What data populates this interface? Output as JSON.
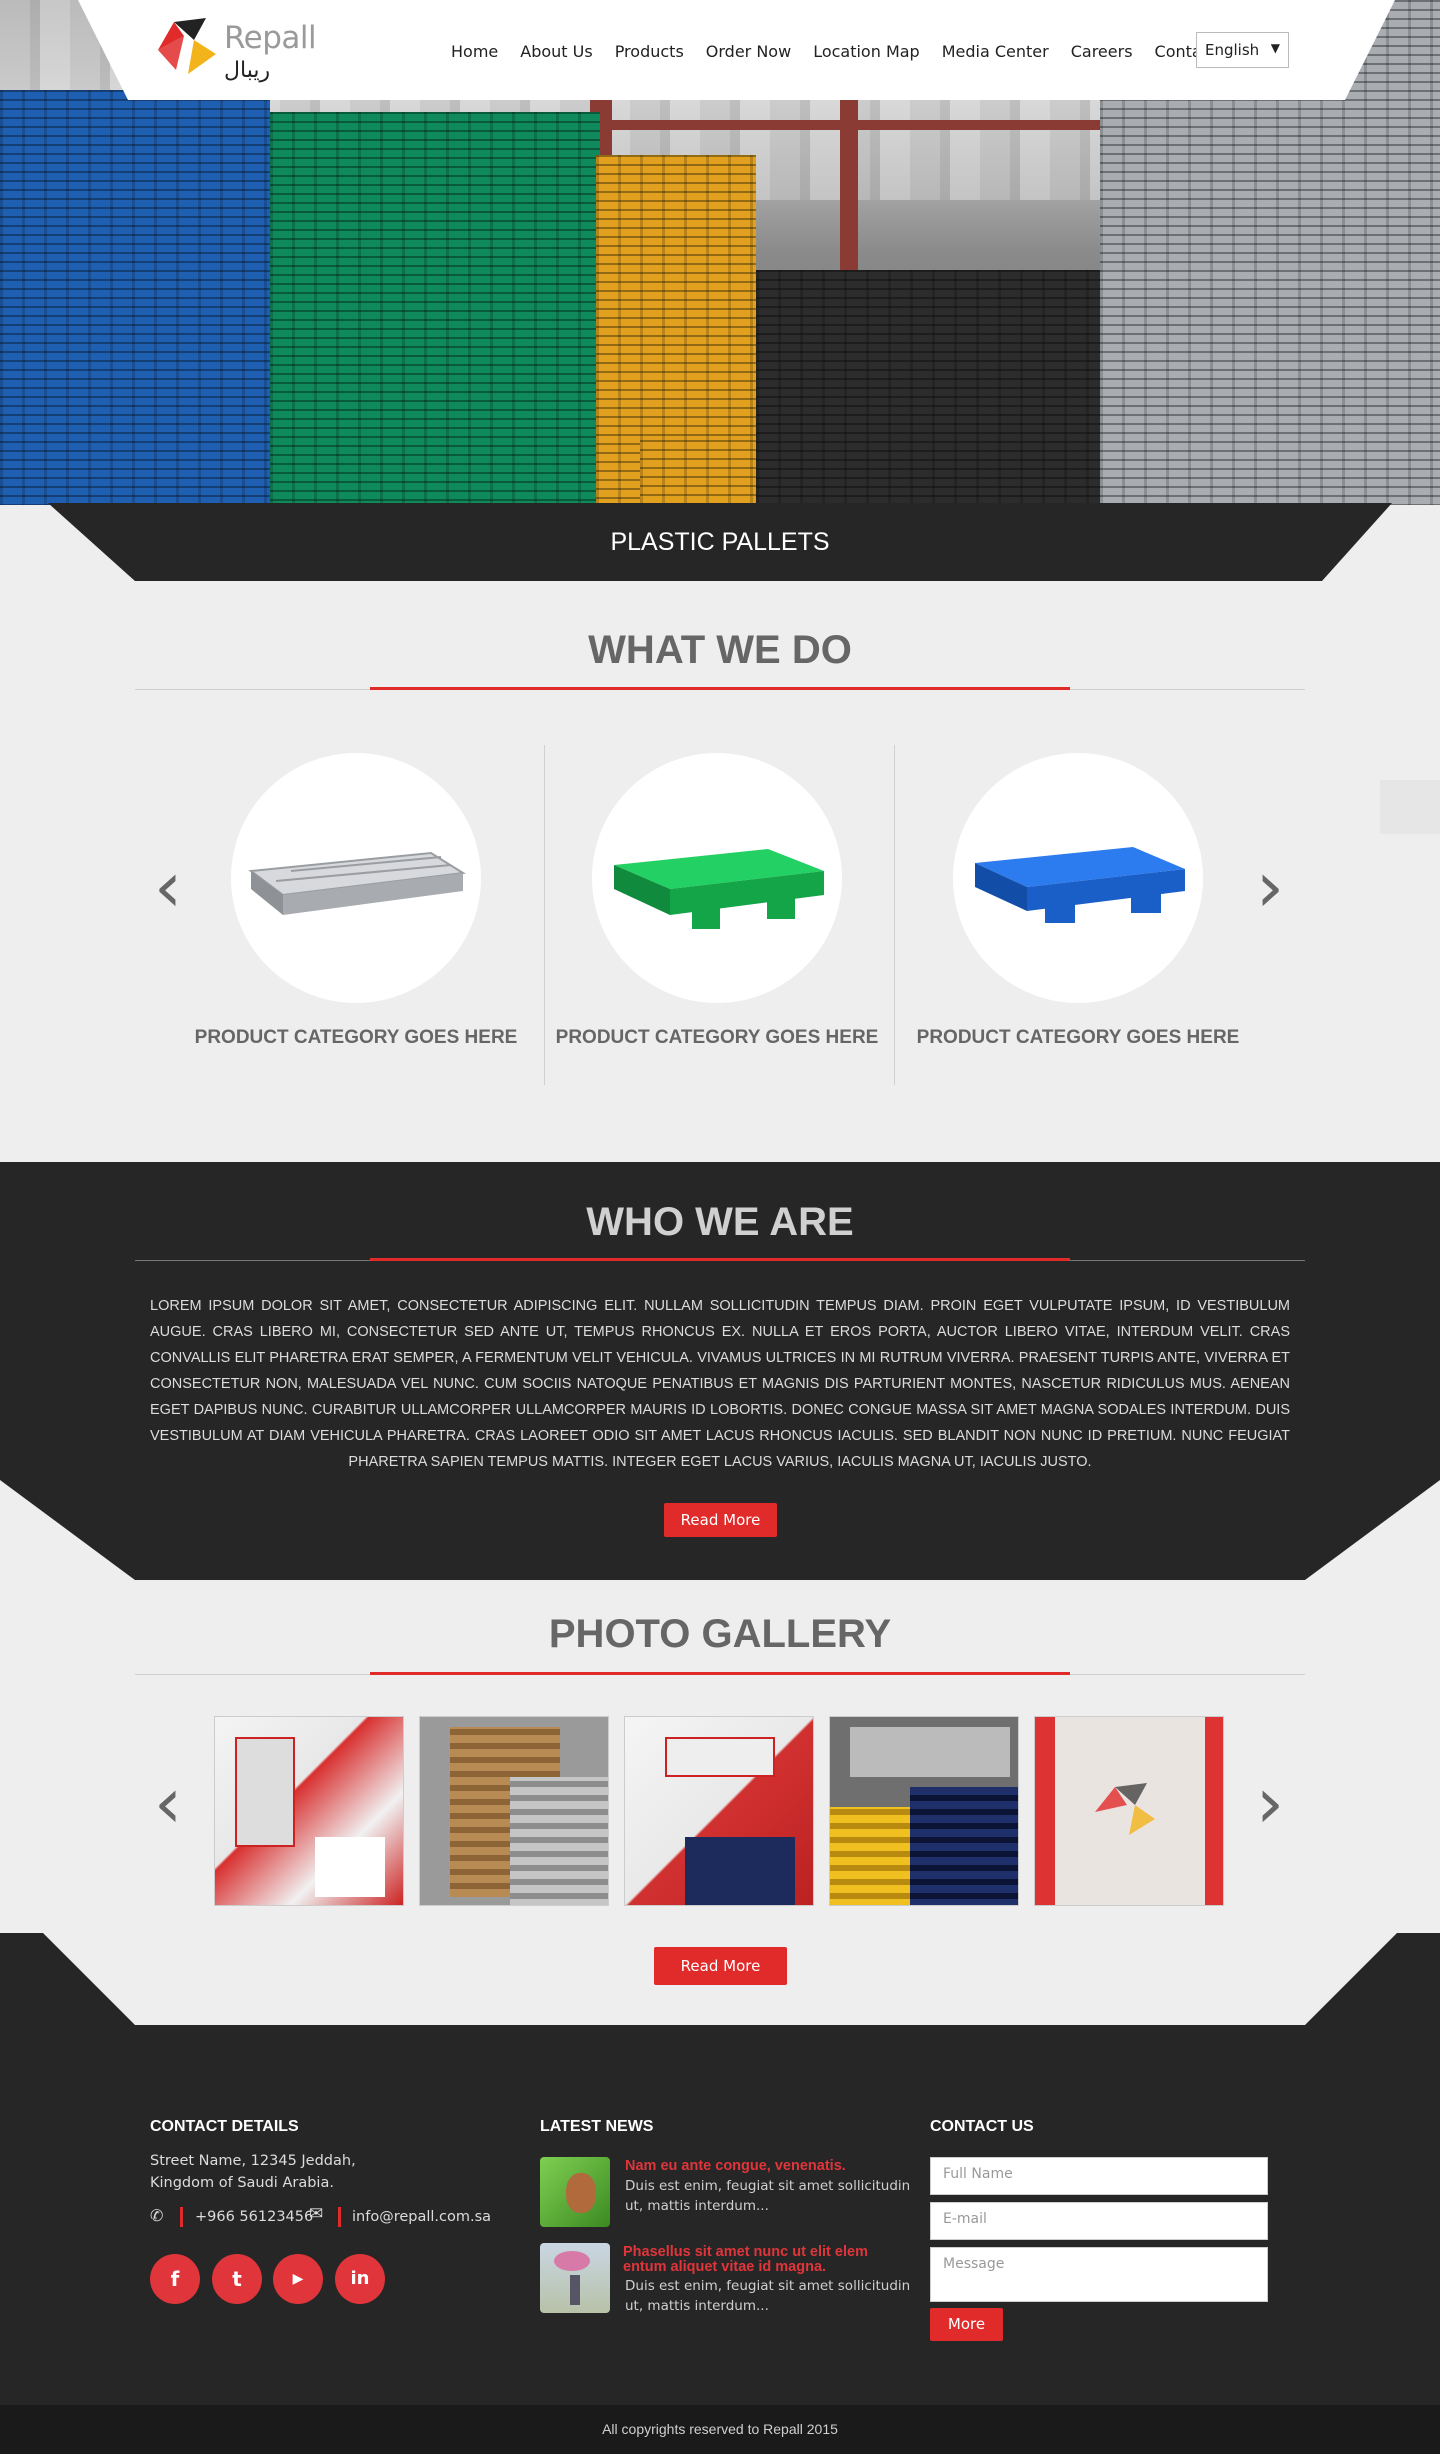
{
  "header": {
    "logo_text": "Repall",
    "logo_arabic": "ريبال",
    "nav": [
      "Home",
      "About Us",
      "Products",
      "Order Now",
      "Location Map",
      "Media Center",
      "Careers",
      "Contact Us"
    ],
    "language": "English"
  },
  "hero": {
    "banner_title": "PLASTIC PALLETS"
  },
  "what_we_do": {
    "title": "WHAT WE DO",
    "products": [
      {
        "name": "PRODUCT CATEGORY GOES HERE",
        "color": "#c9cbce"
      },
      {
        "name": "PRODUCT CATEGORY GOES HERE",
        "color": "#1fc65a"
      },
      {
        "name": "PRODUCT CATEGORY GOES HERE",
        "color": "#1e6fe0"
      }
    ]
  },
  "who_we_are": {
    "title": "WHO WE ARE",
    "body": "Lorem ipsum dolor sit amet, consectetur adipiscing elit. Nullam sollicitudin tempus diam. Proin eget vulputate ipsum, id vestibulum augue. Cras libero mi, consectetur sed ante ut, tempus rhoncus ex. Nulla et eros porta, auctor libero vitae, interdum velit. Cras convallis elit pharetra erat semper, a fermentum velit vehicula. Vivamus ultrices in mi rutrum viverra. Praesent turpis ante, viverra et consectetur non, malesuada vel nunc. Cum sociis natoque penatibus et magnis dis parturient montes, nascetur ridiculus mus. Aenean eget dapibus nunc. Curabitur ullamcorper ullamcorper mauris id lobortis. Donec congue massa sit amet magna sodales interdum. Duis vestibulum at diam vehicula pharetra. Cras laoreet odio sit amet lacus rhoncus iaculis. Sed blandit non nunc id pretium. Nunc feugiat pharetra sapien tempus mattis. Integer eget lacus varius, iaculis magna ut, iaculis justo.",
    "button": "Read More"
  },
  "gallery": {
    "title": "PHOTO GALLERY",
    "button": "Read More"
  },
  "footer": {
    "contact": {
      "title": "CONTACT DETAILS",
      "address_line1": "Street Name, 12345 Jeddah,",
      "address_line2": "Kingdom of Saudi Arabia.",
      "phone": "+966 56123456",
      "email": "info@repall.com.sa"
    },
    "news": {
      "title": "LATEST NEWS",
      "items": [
        {
          "title": "Nam eu ante congue, venenatis.",
          "body_line1": "Duis est enim, feugiat sit amet sollicitudin",
          "body_line2": "ut, mattis interdum..."
        },
        {
          "title_line1": "Phasellus sit amet nunc ut elit elem",
          "title_line2": "entum aliquet vitae id magna.",
          "body_line1": "Duis est enim, feugiat sit amet sollicitudin",
          "body_line2": "ut, mattis interdum..."
        }
      ]
    },
    "contact_form": {
      "title": "CONTACT US",
      "full_name_placeholder": "Full Name",
      "email_placeholder": "E-mail",
      "message_placeholder": "Message",
      "button": "More"
    },
    "copyright": "All copyrights reserved to Repall 2015"
  },
  "colors": {
    "accent": "#e12b2b",
    "dark": "#262626",
    "light": "#eeeeee"
  }
}
